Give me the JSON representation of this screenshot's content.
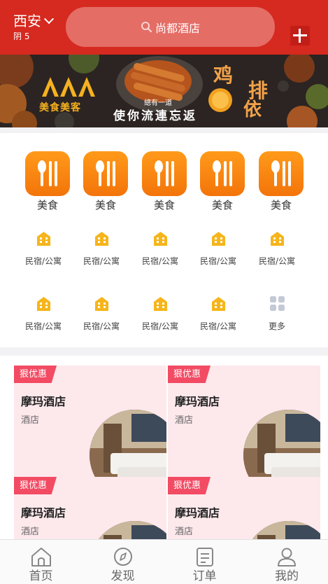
{
  "header": {
    "city": "西安",
    "weather": "阴 5",
    "search_placeholder": "尚都酒店"
  },
  "banner": {
    "logo_text": "美食美客",
    "sub_text": "總有一道",
    "main_text": "使你流連忘返",
    "title_a": "鸡",
    "title_b": "排",
    "title_c": "依"
  },
  "categories": {
    "big": [
      {
        "label": "美食",
        "icon": "fork-spoon-icon"
      },
      {
        "label": "美食",
        "icon": "fork-spoon-icon"
      },
      {
        "label": "美食",
        "icon": "fork-spoon-icon"
      },
      {
        "label": "美食",
        "icon": "fork-spoon-icon"
      },
      {
        "label": "美食",
        "icon": "fork-spoon-icon"
      }
    ],
    "row2": [
      {
        "label": "民宿/公寓",
        "icon": "house-icon"
      },
      {
        "label": "民宿/公寓",
        "icon": "house-icon"
      },
      {
        "label": "民宿/公寓",
        "icon": "house-icon"
      },
      {
        "label": "民宿/公寓",
        "icon": "house-icon"
      },
      {
        "label": "民宿/公寓",
        "icon": "house-icon"
      }
    ],
    "row3": [
      {
        "label": "民宿/公寓",
        "icon": "house-icon"
      },
      {
        "label": "民宿/公寓",
        "icon": "house-icon"
      },
      {
        "label": "民宿/公寓",
        "icon": "house-icon"
      },
      {
        "label": "民宿/公寓",
        "icon": "house-icon"
      },
      {
        "label": "更多",
        "icon": "grid-icon"
      }
    ]
  },
  "deals": [
    {
      "tag": "狠优惠",
      "title": "摩玛酒店",
      "type": "酒店"
    },
    {
      "tag": "狠优惠",
      "title": "摩玛酒店",
      "type": "酒店"
    },
    {
      "tag": "狠优惠",
      "title": "摩玛酒店",
      "type": "酒店"
    },
    {
      "tag": "狠优惠",
      "title": "摩玛酒店",
      "type": "酒店"
    }
  ],
  "tabs": [
    {
      "label": "首页",
      "icon": "home-icon"
    },
    {
      "label": "发现",
      "icon": "compass-icon"
    },
    {
      "label": "订单",
      "icon": "order-icon"
    },
    {
      "label": "我的",
      "icon": "profile-icon"
    }
  ],
  "colors": {
    "header_red": "#d6291f",
    "category_orange": "#f3740a",
    "tag_pink": "#f24b63",
    "house_yellow": "#f6b51b"
  }
}
